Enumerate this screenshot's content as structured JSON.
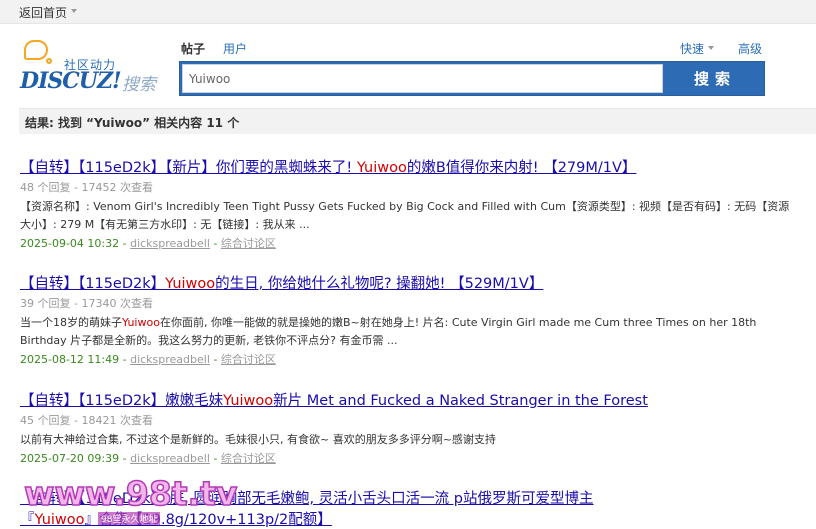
{
  "topbar": {
    "home_label": "返回首页"
  },
  "logo": {
    "slogan": "社区动力",
    "brand": "DISCUZ!",
    "sub": "搜索"
  },
  "tabs": {
    "post": "帖子",
    "user": "用户"
  },
  "quick_label": "快速",
  "advanced_label": "高级",
  "search": {
    "value": "Yuiwoo",
    "button": "搜索"
  },
  "result_summary": "结果: 找到 “Yuiwoo” 相关内容 11 个",
  "results": [
    {
      "title_pre": "【自转】【115eD2k】【新片】你们要的黑蜘蛛来了! ",
      "title_hl": "Yuiwoo",
      "title_post": "的嫩B值得你来内射! 【279M/1V】",
      "meta": "48 个回复 - 17452 次查看",
      "desc_pre": "【资源名称】: Venom Girl's Incredibly Teen Tight Pussy Gets Fucked by Big Cock and Filled with Cum【资源类型】: 视频【是否有码】: 无码【资源大小】: 279 M【有无第三方水印】: 无【链接】: 我从来 ...",
      "desc_hl": "",
      "desc_post": "",
      "date": "2025-09-04 10:32",
      "author": "dickspreadbell",
      "forum": "综合讨论区"
    },
    {
      "title_pre": "【自转】【115eD2k】",
      "title_hl": "Yuiwoo",
      "title_post": "的生日, 你给她什么礼物呢? 操翻她! 【529M/1V】",
      "meta": "39 个回复 - 17340 次查看",
      "desc_pre": "当一个18岁的萌妹子",
      "desc_hl": "Yuiwoo",
      "desc_post": "在你面前, 你唯一能做的就是操她的嫩B~射在她身上! 片名: Cute Virgin Girl made me Cum three Times on her 18th Birthday 片子都是全新的。我这么努力的更新, 老铁你不评点分? 有金币需 ...",
      "date": "2025-08-12 11:49",
      "author": "dickspreadbell",
      "forum": "综合讨论区"
    },
    {
      "title_pre": "【自转】【115eD2k】嫩嫩毛妹",
      "title_hl": "Yuiwoo",
      "title_post": "新片 Met and Fucked a Naked Stranger in the Forest",
      "meta": "45 个回复 - 18421 次查看",
      "desc_pre": "以前有大神给过合集, 不过这个是新鲜的。毛妹很小只, 有食欲~ 喜欢的朋友多多评分啊~感谢支持",
      "desc_hl": "",
      "desc_post": "",
      "date": "2025-07-20 09:39",
      "author": "dickspreadbell",
      "forum": "综合讨论区"
    },
    {
      "title_pre": "【自转】【115eD2k】                    肤, 圆润胸部无毛嫩鲍, 灵活小舌头口活一流 p站俄罗斯可爱型博主",
      "title_hl": "",
      "title_post": "",
      "title2_pre": "『",
      "title2_hl": "Yuiwoo",
      "title2_post": "』合集【19.8g/120v+113p/2配额】"
    }
  ],
  "watermark": {
    "big": "www.98t.tv",
    "small": "98堂永久地址"
  },
  "colors": {
    "link": "#1a0dab",
    "highlight": "#d40000",
    "date": "#3a8a1d",
    "search_button": "#2e6bb5"
  }
}
